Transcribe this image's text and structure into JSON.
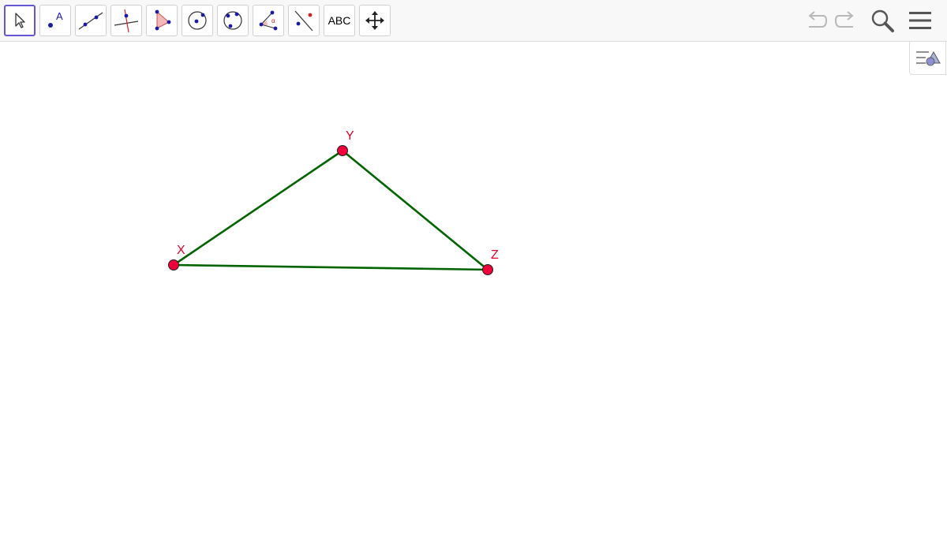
{
  "toolbar": {
    "tools": [
      {
        "name": "move-tool",
        "label": ""
      },
      {
        "name": "point-tool",
        "label": "A"
      },
      {
        "name": "line-tool",
        "label": ""
      },
      {
        "name": "perpendicular-tool",
        "label": ""
      },
      {
        "name": "polygon-tool",
        "label": ""
      },
      {
        "name": "circle-tool",
        "label": ""
      },
      {
        "name": "circle-three-points-tool",
        "label": ""
      },
      {
        "name": "angle-tool",
        "label": "α"
      },
      {
        "name": "reflect-tool",
        "label": ""
      },
      {
        "name": "text-tool",
        "label": "ABC"
      },
      {
        "name": "move-view-tool",
        "label": ""
      }
    ],
    "selected_tool": "move-tool",
    "right_controls": [
      "undo-icon",
      "redo-icon",
      "search-icon",
      "menu-icon"
    ]
  },
  "graphics": {
    "points": [
      {
        "label": "X",
        "color": "#e0002a"
      },
      {
        "label": "Y",
        "color": "#e0002a"
      },
      {
        "label": "Z",
        "color": "#e0002a"
      }
    ],
    "segments": [
      {
        "from": "X",
        "to": "Y"
      },
      {
        "from": "Y",
        "to": "Z"
      },
      {
        "from": "Z",
        "to": "X"
      }
    ],
    "segment_color": "#006400",
    "point_fill": "#f0003a"
  },
  "colors": {
    "accent": "#6557d2",
    "toolbar_bg": "#f8f8f8"
  }
}
